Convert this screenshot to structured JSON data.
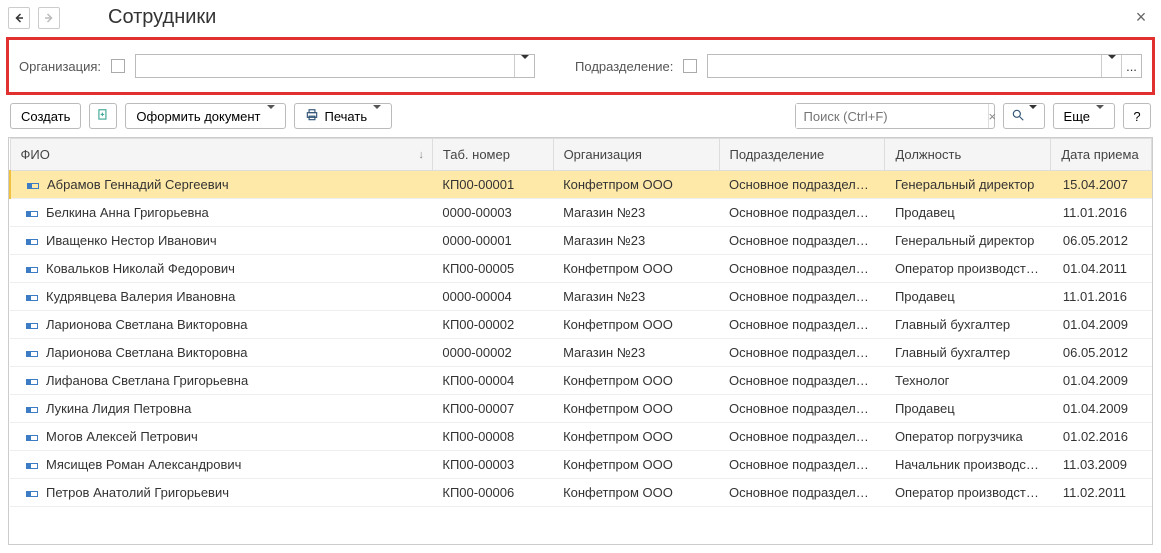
{
  "header": {
    "title": "Сотрудники"
  },
  "filters": {
    "org_label": "Организация:",
    "org_value": "",
    "dept_label": "Подразделение:",
    "dept_value": "",
    "more_btn": "..."
  },
  "toolbar": {
    "create": "Создать",
    "docbtn": "Оформить документ",
    "print": "Печать",
    "search_placeholder": "Поиск (Ctrl+F)",
    "clear": "×",
    "more": "Еще",
    "help": "?"
  },
  "table": {
    "columns": {
      "fio": "ФИО",
      "tab": "Таб. номер",
      "org": "Организация",
      "dept": "Подразделение",
      "pos": "Должность",
      "date": "Дата приема"
    },
    "rows": [
      {
        "fio": "Абрамов Геннадий Сергеевич",
        "tab": "КП00-00001",
        "org": "Конфетпром ООО",
        "dept": "Основное подразделе…",
        "pos": "Генеральный директор",
        "date": "15.04.2007",
        "selected": true
      },
      {
        "fio": "Белкина Анна Григорьевна",
        "tab": "0000-00003",
        "org": "Магазин №23",
        "dept": "Основное подразделе…",
        "pos": "Продавец",
        "date": "11.01.2016"
      },
      {
        "fio": "Иващенко Нестор Иванович",
        "tab": "0000-00001",
        "org": "Магазин №23",
        "dept": "Основное подразделе…",
        "pos": "Генеральный директор",
        "date": "06.05.2012"
      },
      {
        "fio": "Ковальков Николай Федорович",
        "tab": "КП00-00005",
        "org": "Конфетпром ООО",
        "dept": "Основное подразделе…",
        "pos": "Оператор производст…",
        "date": "01.04.2011"
      },
      {
        "fio": "Кудрявцева Валерия Ивановна",
        "tab": "0000-00004",
        "org": "Магазин №23",
        "dept": "Основное подразделе…",
        "pos": "Продавец",
        "date": "11.01.2016"
      },
      {
        "fio": "Ларионова Светлана Викторовна",
        "tab": "КП00-00002",
        "org": "Конфетпром ООО",
        "dept": "Основное подразделе…",
        "pos": "Главный бухгалтер",
        "date": "01.04.2009"
      },
      {
        "fio": "Ларионова Светлана Викторовна",
        "tab": "0000-00002",
        "org": "Магазин №23",
        "dept": "Основное подразделе…",
        "pos": "Главный бухгалтер",
        "date": "06.05.2012"
      },
      {
        "fio": "Лифанова Светлана Григорьевна",
        "tab": "КП00-00004",
        "org": "Конфетпром ООО",
        "dept": "Основное подразделе…",
        "pos": "Технолог",
        "date": "01.04.2009"
      },
      {
        "fio": "Лукина Лидия Петровна",
        "tab": "КП00-00007",
        "org": "Конфетпром ООО",
        "dept": "Основное подразделе…",
        "pos": "Продавец",
        "date": "01.04.2009"
      },
      {
        "fio": "Могов Алексей Петрович",
        "tab": "КП00-00008",
        "org": "Конфетпром ООО",
        "dept": "Основное подразделе…",
        "pos": "Оператор погрузчика",
        "date": "01.02.2016"
      },
      {
        "fio": "Мясищев Роман Александрович",
        "tab": "КП00-00003",
        "org": "Конфетпром ООО",
        "dept": "Основное подразделе…",
        "pos": "Начальник производс…",
        "date": "11.03.2009"
      },
      {
        "fio": "Петров Анатолий Григорьевич",
        "tab": "КП00-00006",
        "org": "Конфетпром ООО",
        "dept": "Основное подразделе…",
        "pos": "Оператор производст…",
        "date": "11.02.2011"
      }
    ]
  }
}
